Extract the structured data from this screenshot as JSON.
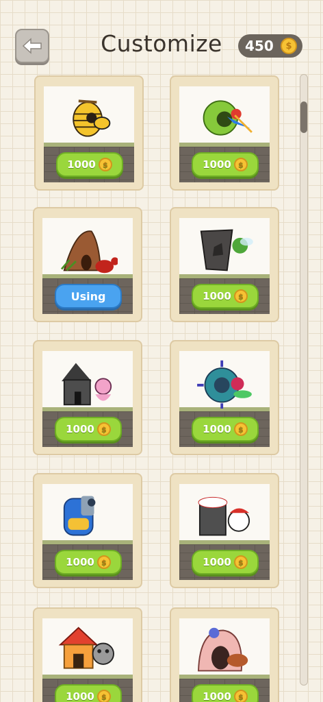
{
  "header": {
    "title": "Customize",
    "coin_balance": "450",
    "back_icon": "arrow-left-icon",
    "coin_icon": "coin-icon"
  },
  "items": [
    {
      "name": "Beehive",
      "label": "1000",
      "status": "buy",
      "icon": "beehive-bird-icon"
    },
    {
      "name": "Leaf Nest",
      "label": "1000",
      "status": "buy",
      "icon": "leaf-nest-bird-icon"
    },
    {
      "name": "Anthill",
      "label": "Using",
      "status": "using",
      "icon": "anthill-ant-icon"
    },
    {
      "name": "Trash Bag",
      "label": "1000",
      "status": "buy",
      "icon": "trash-bag-fly-icon"
    },
    {
      "name": "Haunted House",
      "label": "1000",
      "status": "buy",
      "icon": "haunted-house-icon"
    },
    {
      "name": "Space Pod",
      "label": "1000",
      "status": "buy",
      "icon": "space-pod-icon"
    },
    {
      "name": "Backpack",
      "label": "1000",
      "status": "buy",
      "icon": "backpack-icon"
    },
    {
      "name": "Trash Bin",
      "label": "1000",
      "status": "buy",
      "icon": "trash-bin-baseball-icon"
    },
    {
      "name": "Dog House",
      "label": "1000",
      "status": "buy",
      "icon": "dog-house-icon"
    },
    {
      "name": "Pink Shelter",
      "label": "1000",
      "status": "buy",
      "icon": "pink-shelter-icon"
    }
  ],
  "coin_symbol": "$"
}
